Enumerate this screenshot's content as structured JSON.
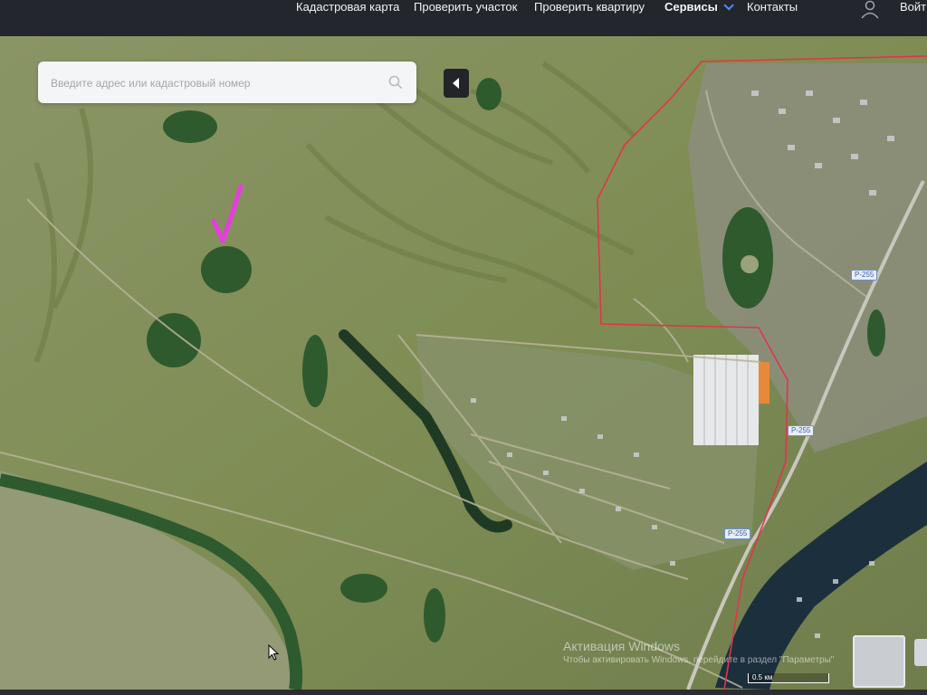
{
  "nav": {
    "items": [
      {
        "label": "Кадастровая карта"
      },
      {
        "label": "Проверить участок"
      },
      {
        "label": "Проверить квартиру"
      },
      {
        "label": "Сервисы"
      },
      {
        "label": "Контакты"
      }
    ],
    "login_label": "Войт"
  },
  "search": {
    "placeholder": "Введите адрес или кадастровый номер",
    "value": ""
  },
  "map": {
    "road_labels": [
      "Р-255",
      "Р-255",
      "Р-255"
    ],
    "scale_label": "0.5 км",
    "boundary_color": "#e0354a",
    "checkmark_color": "#e83be0"
  },
  "watermark": {
    "title": "Активация Windows",
    "subtitle": "Чтобы активировать Windows, перейдите в раздел \"Параметры\""
  },
  "icons": {
    "user": "user-icon",
    "search": "search-icon",
    "collapse": "chevron-left-icon",
    "nav_dropdown": "chevron-down-icon"
  }
}
